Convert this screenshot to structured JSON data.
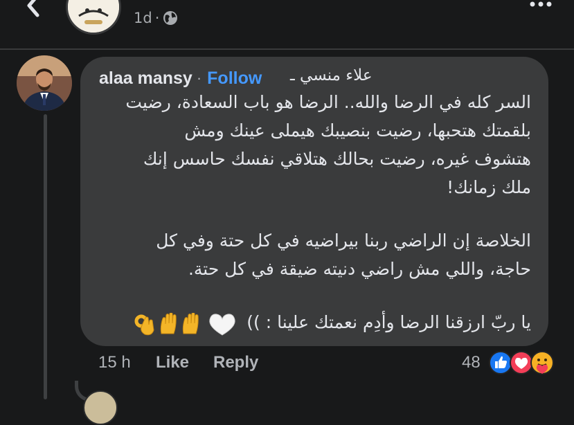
{
  "post": {
    "age": "1d",
    "audience_icon": "globe-icon"
  },
  "comment": {
    "author": "alaa mansy",
    "separator": "·",
    "follow_label": "Follow",
    "author_alias": "علاء منسي ـ",
    "paragraphs": [
      "السر كله في الرضا والله.. الرضا هو باب السعادة، رضيت بلقمتك هتحبها، رضيت بنصيبك هيملى عينك ومش هتشوف غيره، رضيت بحالك هتلاقي نفسك حاسس إنك ملك زمانك!",
      "الخلاصة إن الراضي ربنا بيراضيه في كل حتة وفي كل حاجة، واللي مش راضي دنيته ضيقة في كل حتة.",
      "يا ربّ ارزقنا الرضا وأدِم نعمتك علينا : ))"
    ],
    "emojis": [
      "white-heart",
      "raising-hands",
      "ok-hand"
    ],
    "time_ago": "15 h",
    "like_label": "Like",
    "reply_label": "Reply",
    "reaction_count": "48",
    "reactions": [
      "like",
      "love",
      "care"
    ]
  },
  "colors": {
    "background": "#18191a",
    "bubble": "#3a3b3c",
    "link": "#4599ff",
    "secondary_text": "#b0b3b8"
  }
}
